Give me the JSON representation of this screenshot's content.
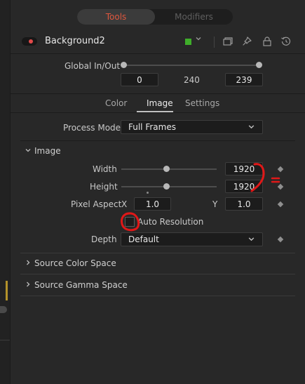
{
  "tabs": [
    {
      "label": "Tools",
      "active": true
    },
    {
      "label": "Modifiers",
      "active": false
    }
  ],
  "node": {
    "name": "Background2",
    "chip_color": "#3fae2a",
    "toggle_color": "#e24a4a"
  },
  "header_icons": [
    "panel-icon",
    "pin-icon",
    "lock-icon",
    "reset-icon"
  ],
  "global": {
    "label": "Global In/Out",
    "in": "0",
    "duration": "240",
    "out": "239"
  },
  "subtabs": [
    {
      "label": "Color",
      "active": false
    },
    {
      "label": "Image",
      "active": true
    },
    {
      "label": "Settings",
      "active": false
    }
  ],
  "process_mode": {
    "label": "Process Mode",
    "value": "Full Frames"
  },
  "image_section": {
    "title": "Image",
    "width": {
      "label": "Width",
      "value": "1920"
    },
    "height": {
      "label": "Height",
      "value": "1920"
    },
    "pixel_aspect": {
      "label": "Pixel Aspect",
      "x_label": "X",
      "x_value": "1.0",
      "y_label": "Y",
      "y_value": "1.0"
    },
    "auto_resolution": {
      "label": "Auto Resolution",
      "checked": false
    },
    "depth": {
      "label": "Depth",
      "value": "Default"
    }
  },
  "collapsed_sections": [
    "Source Color Space",
    "Source Gamma Space"
  ],
  "accent_color": "#e0573e",
  "annotation_color": "#e01818"
}
